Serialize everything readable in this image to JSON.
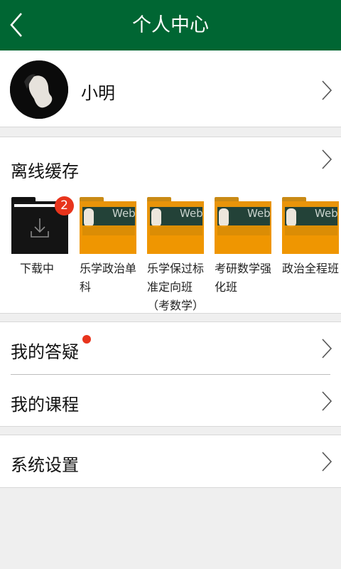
{
  "header": {
    "title": "个人中心",
    "back_icon": "chevron-left-icon"
  },
  "profile": {
    "name": "小明",
    "avatar": "avatar-photo"
  },
  "offline_cache": {
    "label": "离线缓存",
    "downloading": {
      "caption": "下载中",
      "badge_count": "2",
      "icon": "download-icon"
    },
    "items": [
      {
        "caption": "乐学政治单科"
      },
      {
        "caption": "乐学保过标准定向班（考数学）"
      },
      {
        "caption": "考研数学强化班"
      },
      {
        "caption": "政治全程班"
      }
    ],
    "thumb_watermark": "Web"
  },
  "menu": {
    "qa": {
      "label": "我的答疑",
      "has_notification": true
    },
    "courses": {
      "label": "我的课程"
    },
    "settings": {
      "label": "系统设置"
    }
  },
  "colors": {
    "header": "#006633",
    "folder_orange": "#e8940a",
    "badge_red": "#e8341c"
  }
}
